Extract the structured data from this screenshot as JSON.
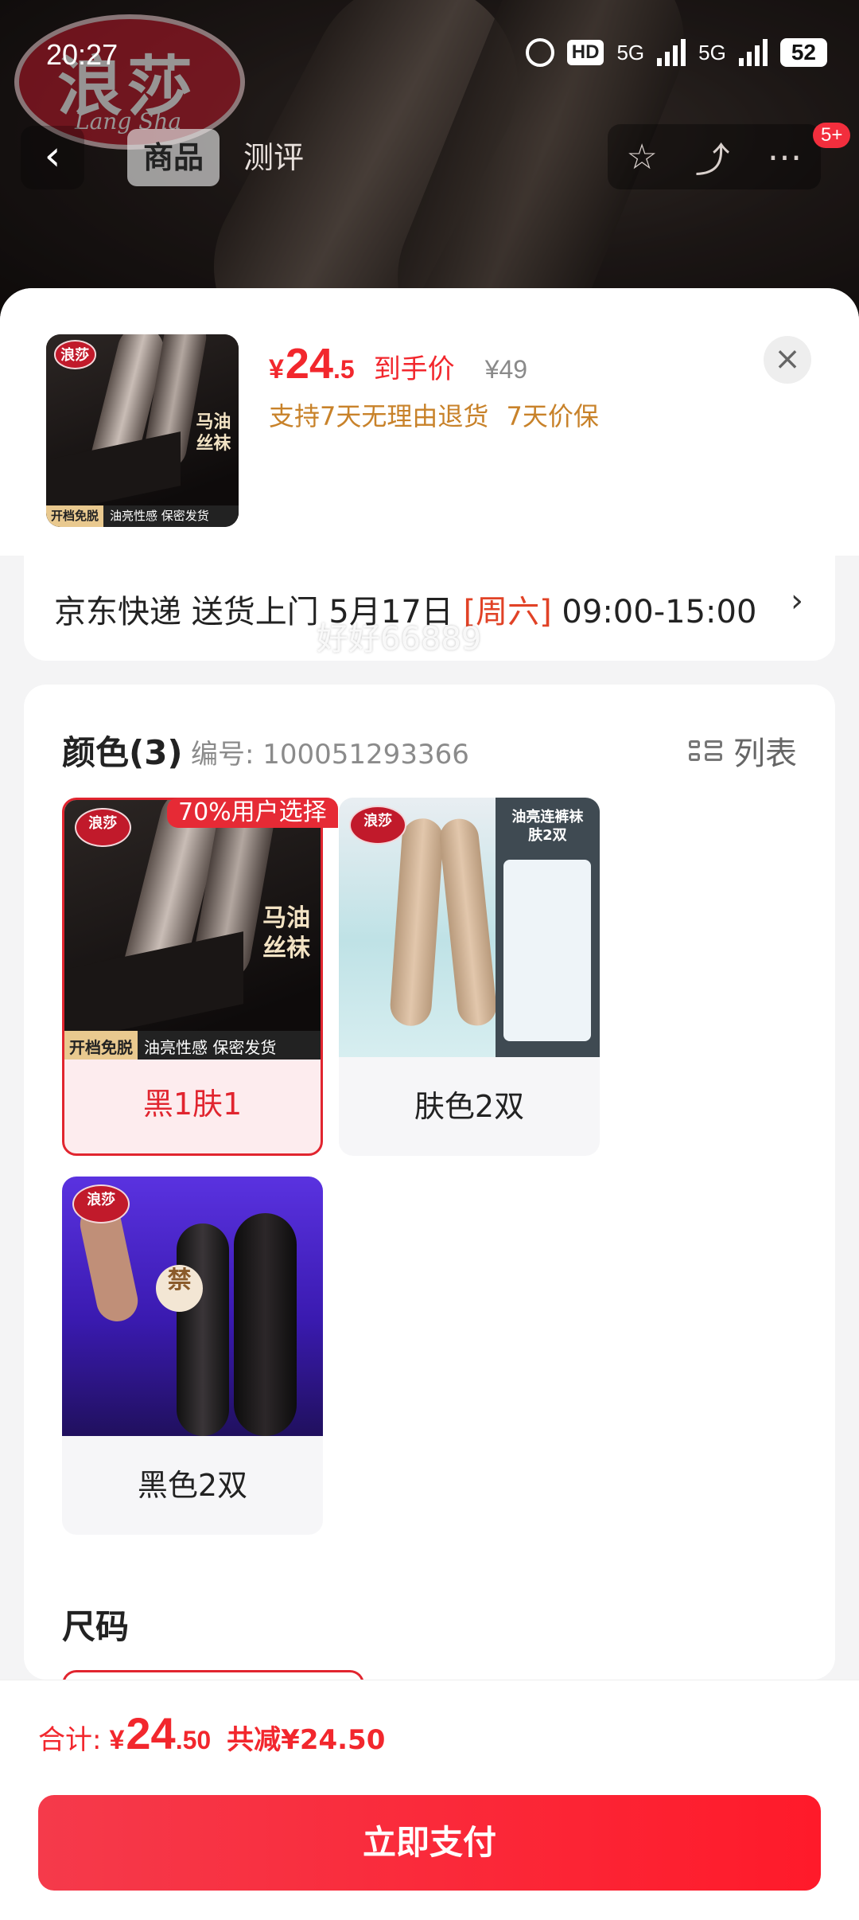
{
  "status_bar": {
    "time": "20:27",
    "hd": "HD",
    "sim1": "5G",
    "sim2": "5G",
    "battery": "52"
  },
  "background_page": {
    "brand_logo_text": "浪莎",
    "brand_logo_sub": "Lang Sha",
    "tabs": [
      {
        "label": "商品",
        "active": true
      },
      {
        "label": "测评",
        "active": false
      }
    ],
    "back_icon": "chevron-left-icon",
    "actions": [
      "star-icon",
      "share-icon",
      "more-icon"
    ],
    "notification_badge": "5+"
  },
  "product": {
    "price_currency": "¥",
    "price_integer": "24",
    "price_decimal": ".5",
    "price_label": "到手价",
    "original_price": "¥49",
    "service_text": "支持7天无理由退货 7天价保"
  },
  "product_image_text": {
    "logo": "浪莎",
    "vertical_title": "马油\n丝袜",
    "strip_left": "开档免脱",
    "strip_right": "油亮性感 保密发货",
    "nude_panel_title": "油亮连裤袜\n肤2双",
    "sticker": "禁"
  },
  "delivery": {
    "text_before": "京东快递 送货上门 5月17日 ",
    "highlight": "[周六]",
    "text_after": " 09:00-15:00",
    "chevron": "›"
  },
  "color_section": {
    "title": "颜色(3)",
    "sku_text": "编号: 100051293366",
    "view_toggle": "列表",
    "popular_tag": "70%用户选择",
    "options": [
      {
        "label": "黑1肤1",
        "selected": true,
        "image": "black-stockings-image"
      },
      {
        "label": "肤色2双",
        "selected": false,
        "image": "nude-stockings-image"
      },
      {
        "label": "黑色2双",
        "selected": false,
        "image": "black-pantyhose-purple-image"
      }
    ]
  },
  "size_section": {
    "title": "尺码"
  },
  "watermark": "好好66889",
  "footer": {
    "total_label": "合计:",
    "total_currency": "¥",
    "total_integer": "24",
    "total_decimal": ".50",
    "discount_text": "共减¥24.50",
    "pay_button": "立即支付"
  },
  "colors": {
    "accent_red": "#f2272d",
    "service_orange": "#c8822a",
    "selected_bg": "#fdecee"
  }
}
